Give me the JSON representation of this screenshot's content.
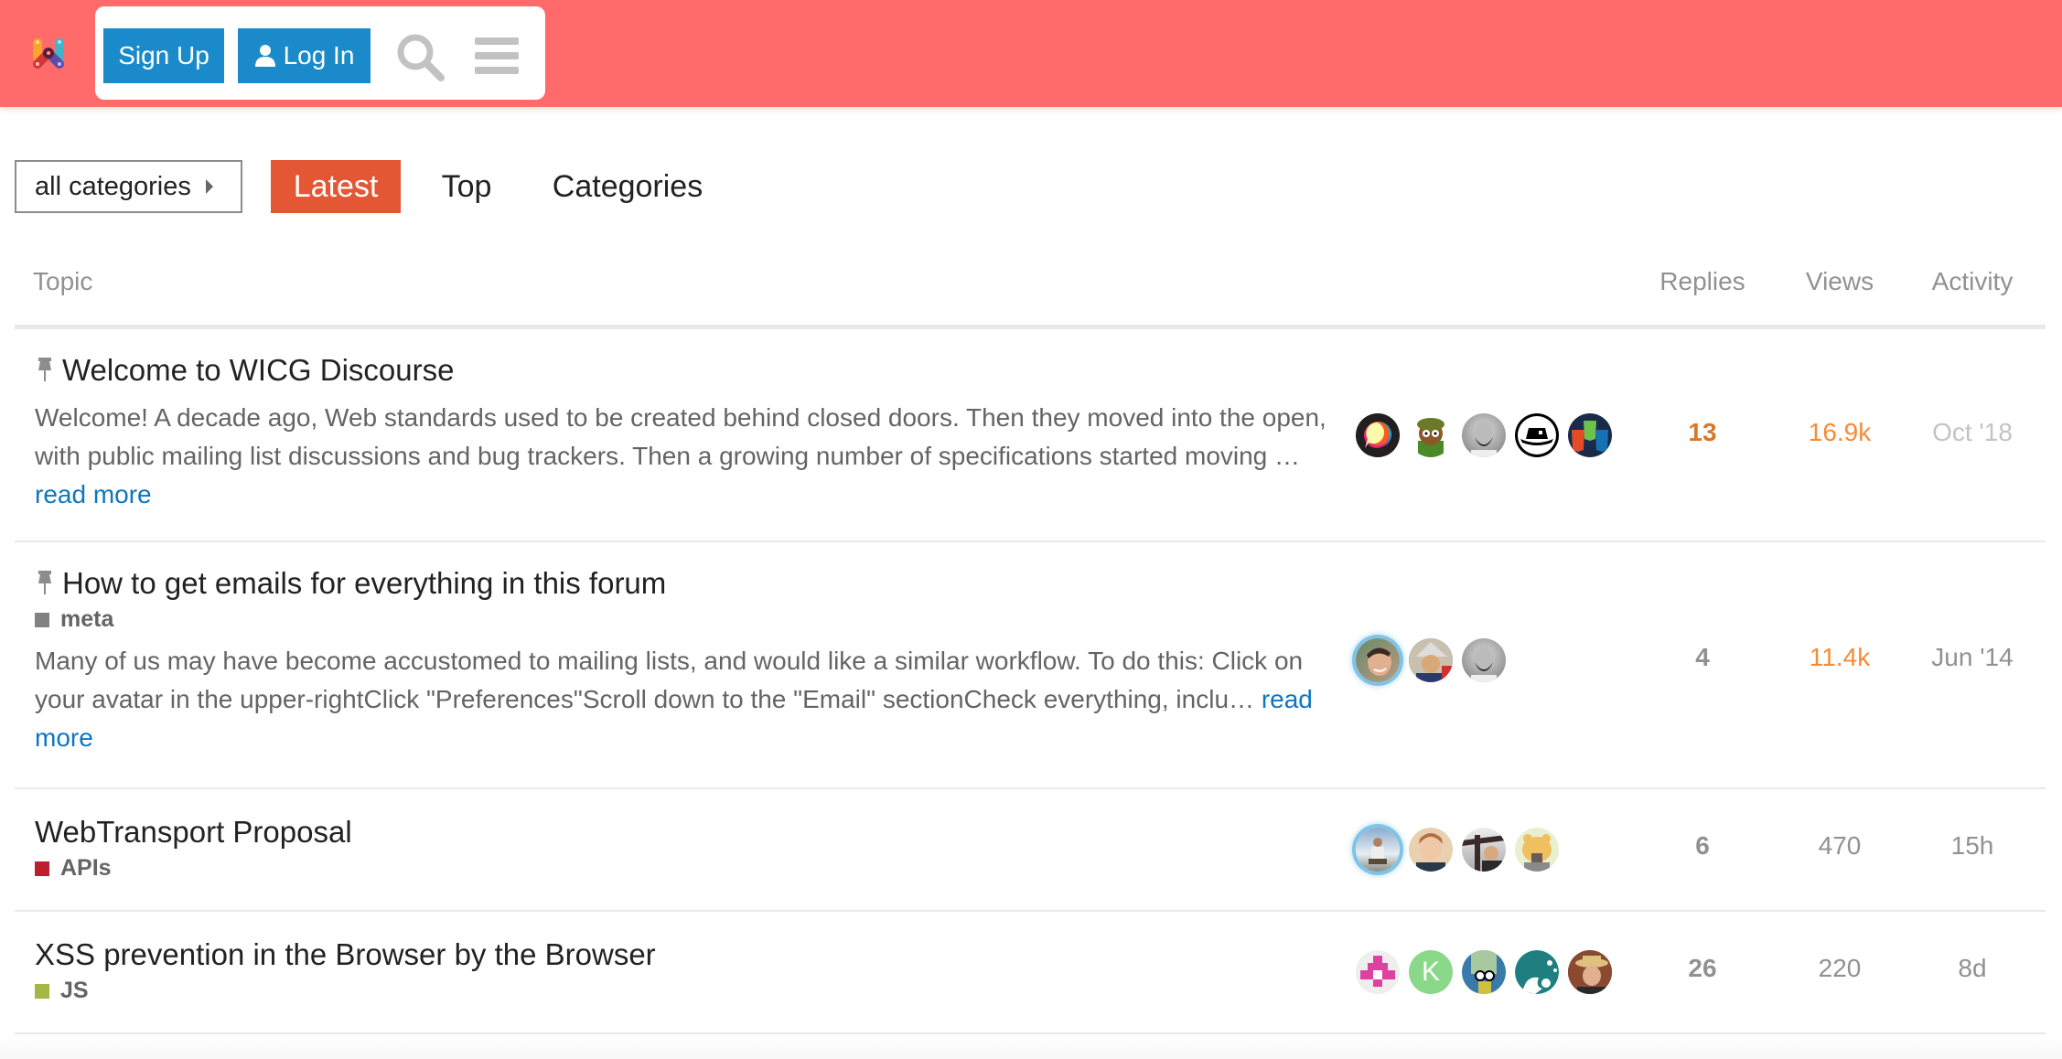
{
  "header": {
    "logo": "wicg-logo",
    "sign_up": "Sign Up",
    "log_in": "Log In",
    "search_icon": "search-icon",
    "menu_icon": "hamburger-menu-icon",
    "bg_color": "#ff6b6b",
    "button_color": "#1a8acb"
  },
  "nav": {
    "category_dropdown": "all categories",
    "tabs": [
      {
        "label": "Latest",
        "active": true
      },
      {
        "label": "Top",
        "active": false
      },
      {
        "label": "Categories",
        "active": false
      }
    ],
    "active_color": "#e45735"
  },
  "table": {
    "columns": [
      "Topic",
      "Replies",
      "Views",
      "Activity"
    ],
    "topics": [
      {
        "pinned": true,
        "title": "Welcome to WICG Discourse",
        "category": null,
        "excerpt": "Welcome! A decade ago, Web standards used to be created behind closed doors. Then they moved into the open, with public mailing list discussions and bug trackers. Then a growing number of specifications started moving … ",
        "read_more": "read more",
        "posters": [
          "discourse-logo-avatar",
          "cartoon-avatar",
          "bearded-man-avatar",
          "hat-avatar",
          "html-js-css-avatar"
        ],
        "replies": "13",
        "views": "16.9k",
        "activity": "Oct '18"
      },
      {
        "pinned": true,
        "title": "How to get emails for everything in this forum",
        "category": {
          "name": "meta",
          "color": "#808281"
        },
        "excerpt": "Many of us may have become accustomed to mailing lists, and would like a similar workflow. To do this: Click on your avatar in the upper-rightClick \"Preferences\"Scroll down to the \"Email\" sectionCheck everything, inclu… ",
        "read_more": "read more",
        "posters": [
          "smiling-man-avatar",
          "foil-hat-avatar",
          "bearded-man-avatar"
        ],
        "replies": "4",
        "views": "11.4k",
        "activity": "Jun '14"
      },
      {
        "pinned": false,
        "title": "WebTransport Proposal",
        "category": {
          "name": "APIs",
          "color": "#bf1e2e"
        },
        "excerpt": null,
        "posters": [
          "mountain-man-avatar",
          "redhead-man-avatar",
          "statue-man-avatar",
          "bear-avatar"
        ],
        "replies": "6",
        "views": "470",
        "activity": "15h"
      },
      {
        "pinned": false,
        "title": "XSS prevention in the Browser by the Browser",
        "category": {
          "name": "JS",
          "color": "#a3b944"
        },
        "excerpt": null,
        "posters": [
          "pixel-pink-avatar",
          "letter-k-avatar",
          "cartoon-glasses-avatar",
          "teal-logo-avatar",
          "hat-man-avatar"
        ],
        "posters_letter": "K",
        "replies": "26",
        "views": "220",
        "activity": "8d"
      }
    ]
  }
}
